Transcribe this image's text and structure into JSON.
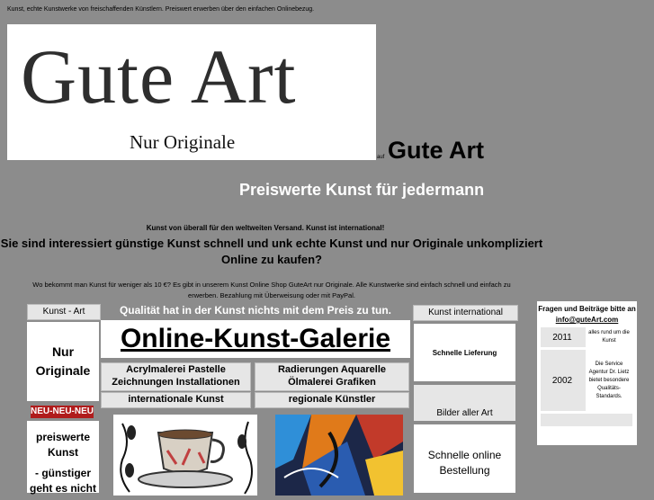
{
  "tagline": "Kunst, echte Kunstwerke von freischaffenden Künstlern. Preiswert erwerben über den einfachen Onlinebezug.",
  "logo": {
    "title": "Gute Art",
    "subtitle": "Nur Originale"
  },
  "header": {
    "auf": "auf",
    "site_name": "Gute Art",
    "subtitle": "Preiswerte Kunst für jedermann"
  },
  "intro": {
    "international": "Kunst von überall für den weltweiten Versand. Kunst ist international!",
    "headline": "Sie sind interessiert günstige Kunst schnell und unk echte Kunst und nur Originale unkompliziert Online zu kaufen?",
    "description": "Wo bekommt man Kunst für weniger als 10 €? Es gibt in unserem Kunst Online Shop GuteArt nur Originale. Alle Kunstwerke sind einfach schnell und einfach zu erwerben. Bezahlung mit Überweisung oder mit PayPal."
  },
  "left": {
    "header": "Kunst - Art",
    "nur_originale": "Nur Originale",
    "badge": "NEU-NEU-NEU",
    "preiswerte": "preiswerte Kunst",
    "guenstiger": "- günstiger geht es nicht"
  },
  "center": {
    "quality": "Qualität hat in der Kunst nichts mit dem Preis zu tun.",
    "title": "Online-Kunst-Galerie",
    "cat1_line1": "Acrylmalerei   Pastelle",
    "cat1_line2": "Zeichnungen   Installationen",
    "cat2_line1": "Radierungen   Aquarelle",
    "cat2_line2": "Ölmalerei   Grafiken",
    "cat3": "internationale Kunst",
    "cat4": "regionale Künstler"
  },
  "right": {
    "header": "Kunst international",
    "lieferung": "Schnelle Lieferung",
    "bilder": "Bilder aller Art",
    "bestellung": "Schnelle online Bestellung"
  },
  "sidebar": {
    "question": "Fragen und Beiträge bitte an",
    "email": "info@guteArt.com",
    "rows": [
      {
        "year": "2011",
        "text": "alles rund um die Kunst"
      },
      {
        "year": "2002",
        "text": "Die Service Agentur Dr. Lietz bietet besondere Qualitäts-Standards."
      }
    ]
  },
  "colors": {
    "background": "#8c8c8c",
    "badge": "#b01c1c",
    "panel": "#e6e6e6"
  }
}
